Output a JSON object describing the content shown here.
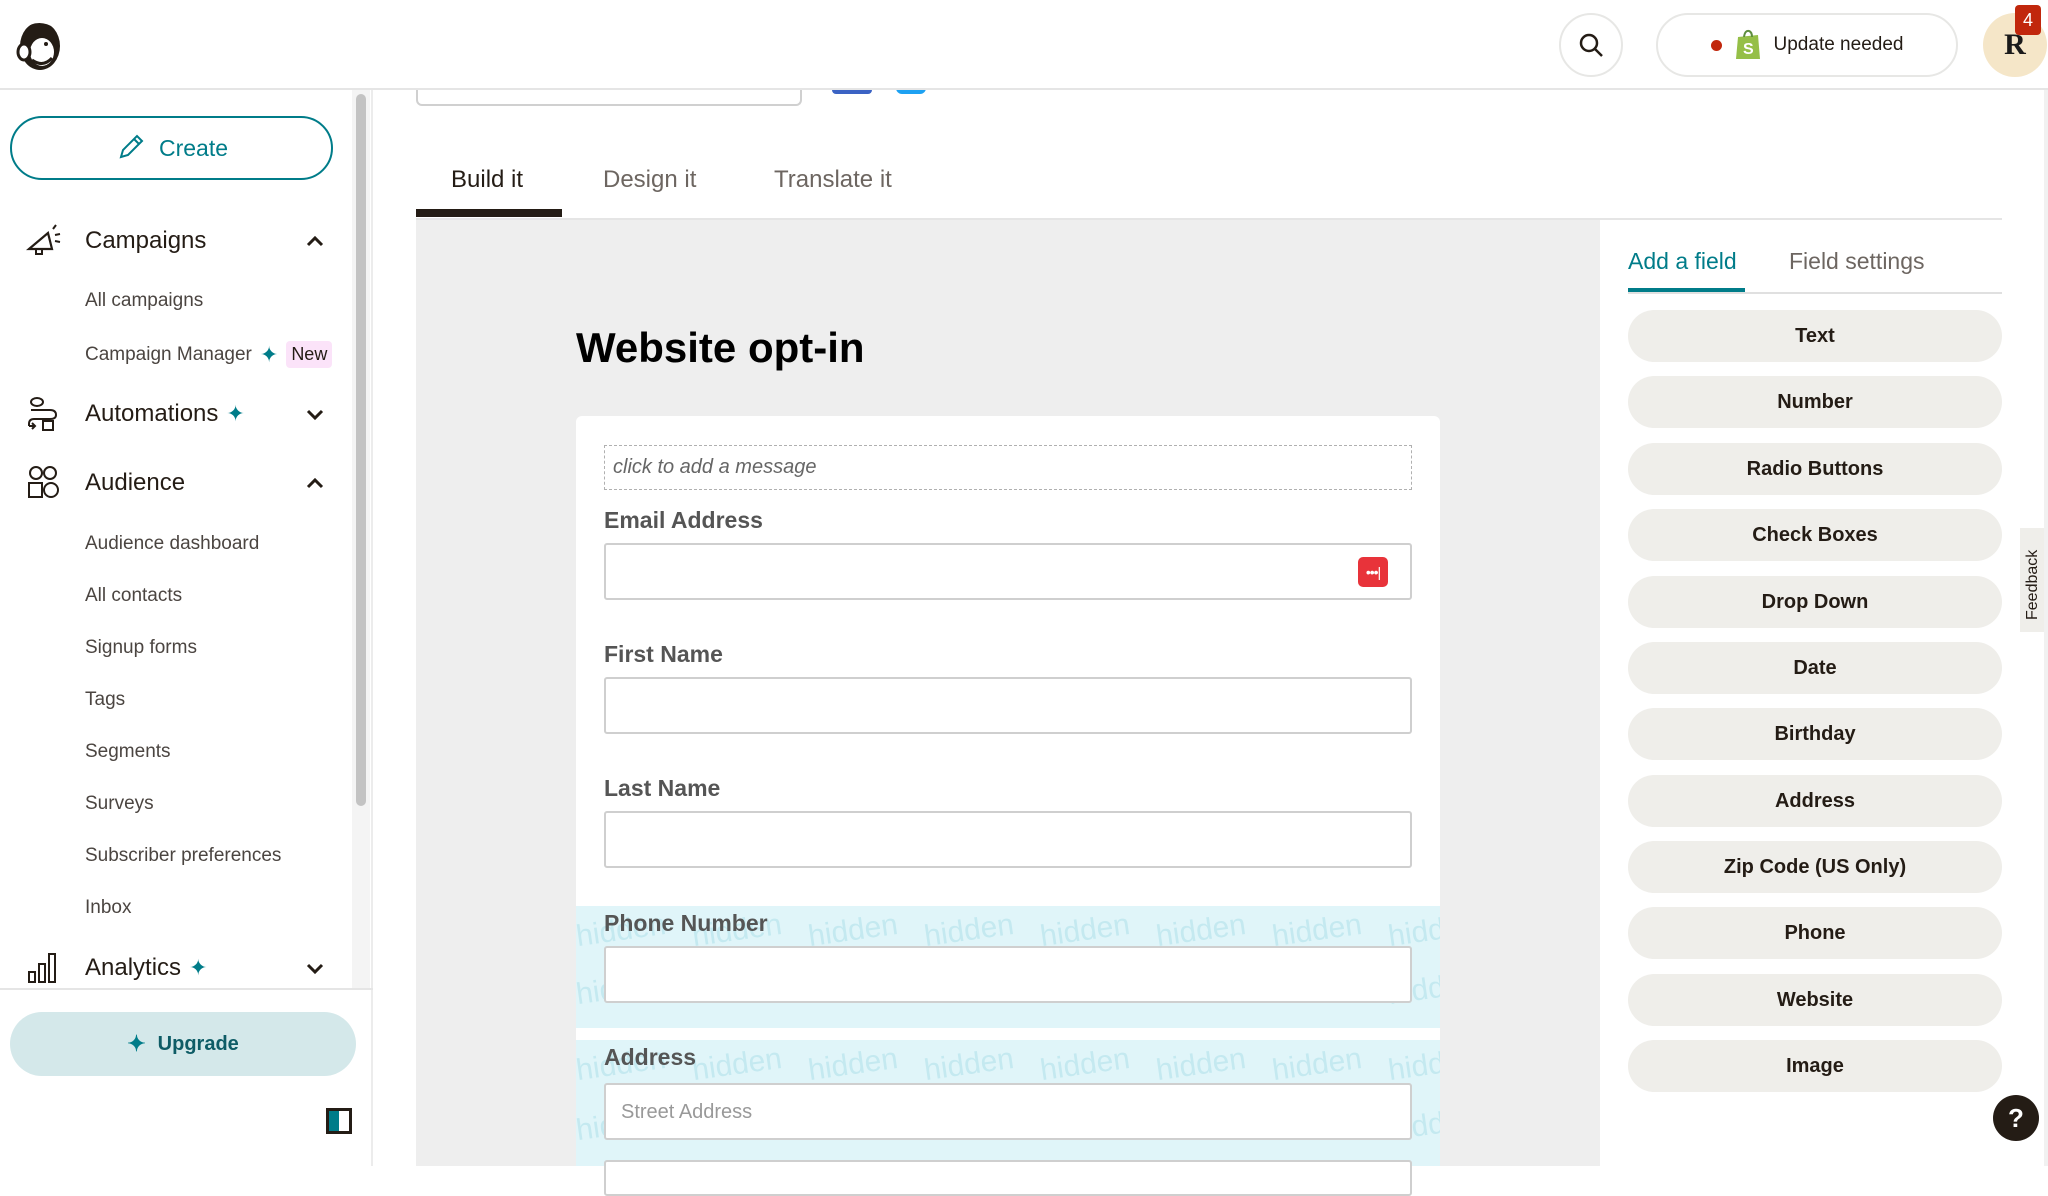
{
  "header": {
    "logo": "mailchimp-freddie-logo",
    "search_icon": "search-icon",
    "update_button": {
      "label": "Update needed",
      "status_color": "#c1270c",
      "icon": "shopify-bag-icon"
    },
    "avatar": {
      "initial": "R",
      "notification_count": "4"
    }
  },
  "sidebar": {
    "create_label": "Create",
    "sections": [
      {
        "label": "Campaigns",
        "icon": "megaphone-icon",
        "expanded": true,
        "sparkle": false,
        "items": [
          {
            "label": "All campaigns"
          },
          {
            "label": "Campaign Manager",
            "sparkle": true,
            "badge": "New"
          }
        ]
      },
      {
        "label": "Automations",
        "icon": "automation-flow-icon",
        "expanded": false,
        "sparkle": true,
        "items": []
      },
      {
        "label": "Audience",
        "icon": "audience-icon",
        "expanded": true,
        "sparkle": false,
        "items": [
          {
            "label": "Audience dashboard"
          },
          {
            "label": "All contacts"
          },
          {
            "label": "Signup forms"
          },
          {
            "label": "Tags"
          },
          {
            "label": "Segments"
          },
          {
            "label": "Surveys"
          },
          {
            "label": "Subscriber preferences"
          },
          {
            "label": "Inbox"
          }
        ]
      },
      {
        "label": "Analytics",
        "icon": "bar-chart-icon",
        "expanded": false,
        "sparkle": true,
        "items": []
      }
    ],
    "upgrade_label": "Upgrade",
    "sparkle_glyph": "✦"
  },
  "main": {
    "tabs": [
      {
        "label": "Build it",
        "active": true
      },
      {
        "label": "Design it",
        "active": false
      },
      {
        "label": "Translate it",
        "active": false
      }
    ],
    "form": {
      "title": "Website opt-in",
      "message_placeholder": "click to add a message",
      "fields": [
        {
          "label": "Email Address",
          "value": "",
          "hidden": false
        },
        {
          "label": "First Name",
          "value": "",
          "hidden": false
        },
        {
          "label": "Last Name",
          "value": "",
          "hidden": false
        },
        {
          "label": "Phone Number",
          "value": "",
          "hidden": true
        },
        {
          "label": "Address",
          "placeholder": "Street Address",
          "hidden": true
        }
      ],
      "hidden_watermark": "hidden"
    }
  },
  "right_panel": {
    "tabs": [
      {
        "label": "Add a field",
        "active": true
      },
      {
        "label": "Field settings",
        "active": false
      }
    ],
    "field_types": [
      "Text",
      "Number",
      "Radio Buttons",
      "Check Boxes",
      "Drop Down",
      "Date",
      "Birthday",
      "Address",
      "Zip Code (US Only)",
      "Phone",
      "Website",
      "Image"
    ]
  },
  "feedback_label": "Feedback",
  "help_label": "?",
  "colors": {
    "brand": "#007c89",
    "text": "#241c15",
    "canvas": "#eeeeee",
    "hidden_band": "#e0f5f9",
    "alert": "#c1270c"
  }
}
